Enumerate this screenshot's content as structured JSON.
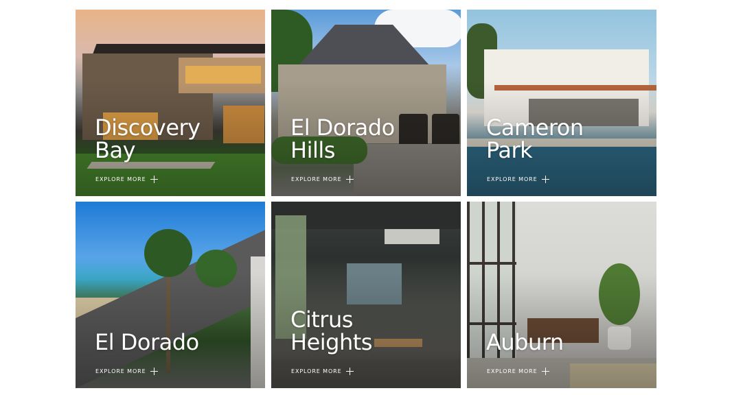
{
  "explore_label": "EXPLORE MORE",
  "cards": [
    {
      "title": "Discovery\nBay",
      "explore": "EXPLORE MORE",
      "image": "modern-house-dusk"
    },
    {
      "title": "El Dorado\nHills",
      "explore": "EXPLORE MORE",
      "image": "stone-chateau"
    },
    {
      "title": "Cameron\nPark",
      "explore": "EXPLORE MORE",
      "image": "white-villa-pool"
    },
    {
      "title": "El Dorado",
      "explore": "EXPLORE MORE",
      "image": "beach-boulevard-palms"
    },
    {
      "title": "Citrus\nHeights",
      "explore": "EXPLORE MORE",
      "image": "industrial-cafe"
    },
    {
      "title": "Auburn",
      "explore": "EXPLORE MORE",
      "image": "concrete-loft"
    }
  ],
  "icons": {
    "explore": "plus-icon"
  }
}
